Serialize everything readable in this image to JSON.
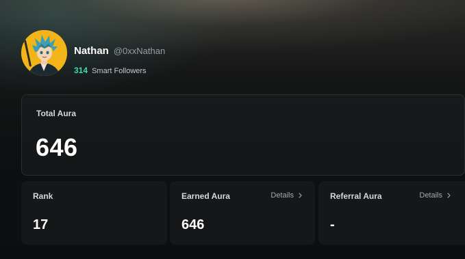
{
  "profile": {
    "display_name": "Nathan",
    "handle": "@0xxNathan",
    "smart_followers_count": "314",
    "smart_followers_label": "Smart Followers",
    "avatar": "anime-avatar-blue-hair"
  },
  "total_aura": {
    "title": "Total Aura",
    "value": "646"
  },
  "stats": {
    "rank": {
      "title": "Rank",
      "value": "17"
    },
    "earned": {
      "title": "Earned Aura",
      "value": "646",
      "details_label": "Details"
    },
    "referral": {
      "title": "Referral Aura",
      "value": "-",
      "details_label": "Details"
    }
  },
  "colors": {
    "accent_green": "#3fd8b0",
    "avatar_bg": "#f2b418",
    "card_bg": "#151719"
  }
}
